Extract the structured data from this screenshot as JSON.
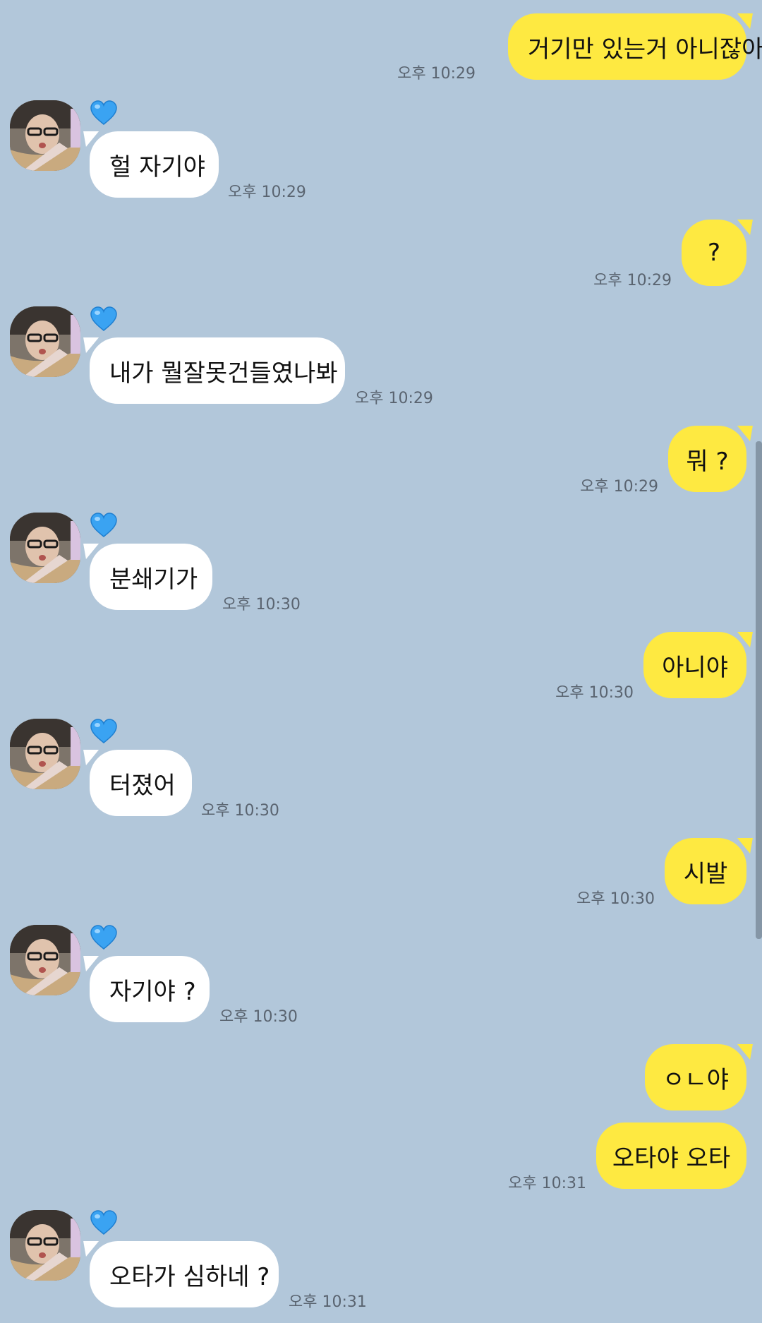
{
  "colors": {
    "background": "#b2c7da",
    "outgoing_bubble": "#fee941",
    "incoming_bubble": "#ffffff",
    "timestamp_text": "#5a6470",
    "heart": "#3aa3f2"
  },
  "contact": {
    "avatar_icon": "profile-photo",
    "badge_icon": "blue-heart-emoji"
  },
  "messages": [
    {
      "dir": "out",
      "text": "거기만 있는거 아니잖아",
      "time": "오후 10:29"
    },
    {
      "dir": "in",
      "text": "헐 자기야",
      "time": "오후 10:29"
    },
    {
      "dir": "out",
      "text": "?",
      "time": "오후 10:29"
    },
    {
      "dir": "in",
      "text": "내가 뭘잘못건들였나봐",
      "time": "오후 10:29"
    },
    {
      "dir": "out",
      "text": "뭐 ?",
      "time": "오후 10:29"
    },
    {
      "dir": "in",
      "text": "분쇄기가",
      "time": "오후 10:30"
    },
    {
      "dir": "out",
      "text": "아니야",
      "time": "오후 10:30"
    },
    {
      "dir": "in",
      "text": "터졌어",
      "time": "오후 10:30"
    },
    {
      "dir": "out",
      "text": "시발",
      "time": "오후 10:30"
    },
    {
      "dir": "in",
      "text": "자기야 ?",
      "time": "오후 10:30"
    },
    {
      "dir": "out",
      "text": "ㅇㄴ야",
      "time": ""
    },
    {
      "dir": "out",
      "text": "오타야 오타",
      "time": "오후 10:31"
    },
    {
      "dir": "in",
      "text": "오타가 심하네 ?",
      "time": "오후 10:31"
    }
  ]
}
